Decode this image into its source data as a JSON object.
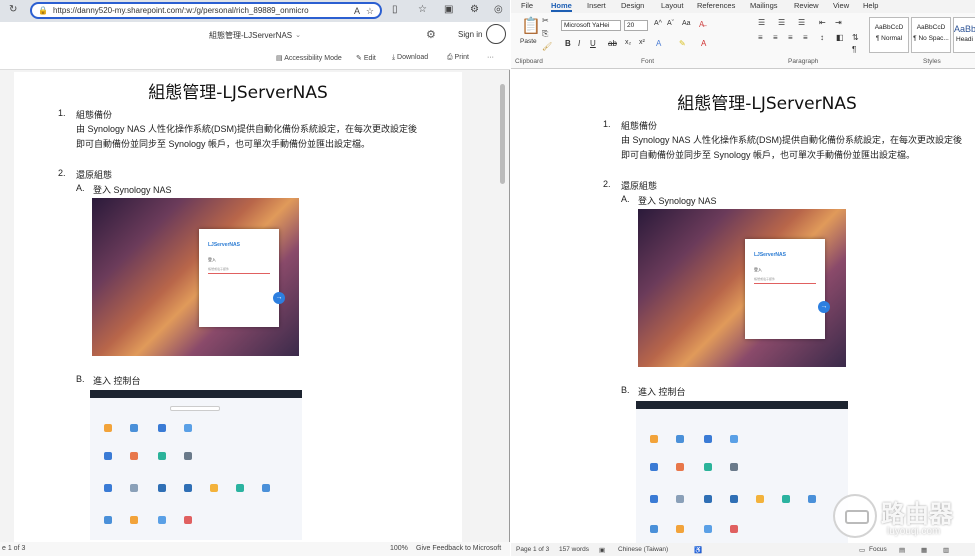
{
  "browser": {
    "url": "https://danny520-my.sharepoint.com/:w:/g/personal/rich_89889_onmicro",
    "refresh_icon": "refresh-icon"
  },
  "sharepoint": {
    "doc_title": "組態管理-LJServerNAS",
    "sign_in": "Sign in",
    "tools": {
      "accessibility": "Accessibility Mode",
      "edit": "Edit",
      "download": "Download",
      "print": "Print",
      "more": "···"
    },
    "status": {
      "page": "e 1 of 3",
      "zoom": "100%",
      "feedback": "Give Feedback to Microsoft"
    }
  },
  "document": {
    "title": "組態管理-LJServerNAS",
    "sections": [
      {
        "num": "1.",
        "heading": "組態備份",
        "body": "由 Synology NAS 人性化操作系統(DSM)提供自動化備份系統設定，在每次更改設定後即可自動備份並同步至 Synology 帳戶，也可單次手動備份並匯出設定檔。"
      },
      {
        "num": "2.",
        "heading": "還原組態"
      }
    ],
    "sub_a": {
      "label": "A.",
      "text": "登入 Synology NAS"
    },
    "sub_b": {
      "label": "B.",
      "text": "進入 控制台"
    },
    "login_card": {
      "title": "LJServerNAS",
      "label": "登入",
      "placeholder": "帳號或電子郵件"
    }
  },
  "word": {
    "menu": [
      "File",
      "Home",
      "Insert",
      "Design",
      "Layout",
      "References",
      "Mailings",
      "Review",
      "View",
      "Help"
    ],
    "active_tab": "Home",
    "font_name": "Microsoft YaHei",
    "font_size": "20",
    "groups": {
      "clipboard": "Clipboard",
      "font": "Font",
      "paragraph": "Paragraph",
      "styles": "Styles"
    },
    "paste": "Paste",
    "styles": [
      {
        "sample": "AaBbCcD",
        "name": "¶ Normal"
      },
      {
        "sample": "AaBbCcD",
        "name": "¶ No Spac..."
      },
      {
        "sample": "AaBb",
        "name": "Headi"
      }
    ],
    "status": {
      "page": "Page 1 of 3",
      "words": "157 words",
      "language": "Chinese (Taiwan)",
      "focus": "Focus"
    }
  },
  "watermark": {
    "text": "路由器",
    "sub": "luyouqi.com"
  }
}
